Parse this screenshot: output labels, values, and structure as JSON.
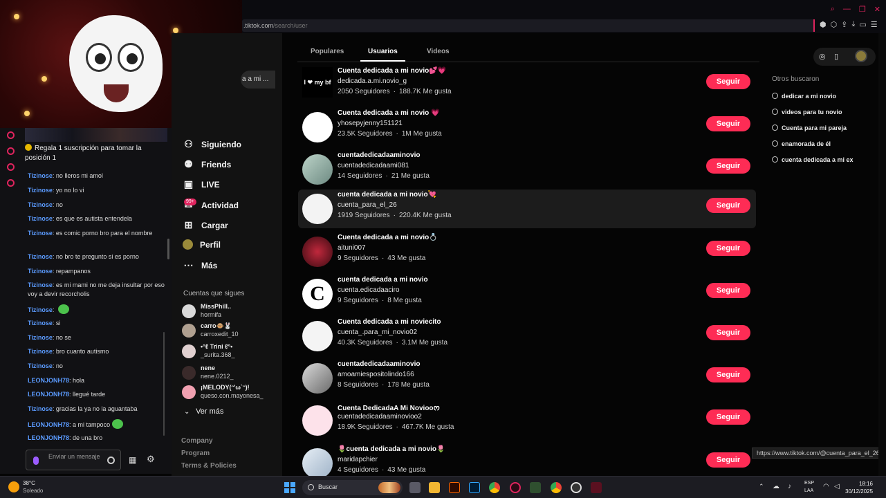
{
  "browser": {
    "url_host": ".tiktok.com",
    "url_path": "/search/user"
  },
  "search": {
    "query_visible": "a a mi ..."
  },
  "nav": {
    "items": [
      {
        "label": "Siguiendo",
        "icon": "following-icon"
      },
      {
        "label": "Friends",
        "icon": "friends-icon"
      },
      {
        "label": "LIVE",
        "icon": "live-icon"
      },
      {
        "label": "Actividad",
        "icon": "activity-icon",
        "badge": "99+"
      },
      {
        "label": "Cargar",
        "icon": "upload-icon"
      },
      {
        "label": "Perfil",
        "icon": "profile-icon"
      },
      {
        "label": "Más",
        "icon": "more-icon"
      }
    ],
    "following_title": "Cuentas que sigues",
    "following": [
      {
        "name": "MissPhill..",
        "sub": "hormifa"
      },
      {
        "name": "carro🐵🐰",
        "sub": "carroxedit_10"
      },
      {
        "name": "•°ℓ Trini ℓ°•",
        "sub": "_surita.368_"
      },
      {
        "name": "nene",
        "sub": "nene.0212_"
      },
      {
        "name": "¡MELODY(ᵔ'ω`ᵔ)!",
        "sub": "queso.con.mayonesa_"
      }
    ],
    "see_more": "Ver más",
    "footer": [
      "Company",
      "Program",
      "Terms & Policies"
    ]
  },
  "tabs": [
    "Populares",
    "Usuarios",
    "Videos"
  ],
  "users": [
    {
      "name": "Cuenta dedicada a mi novio💕💗",
      "handle": "dedicada.a.mi.novio_g",
      "followers": "2050 Seguidores",
      "likes": "188.7K Me gusta",
      "avatar_text": "I ❤ my bf"
    },
    {
      "name": "Cuenta dedicada a mi novio 💗",
      "handle": "yhosepyjenny151121",
      "followers": "23.5K Seguidores",
      "likes": "1M Me gusta",
      "avatar_text": ""
    },
    {
      "name": "cuentadedicadaaminovio",
      "handle": "cuentadedicadaami081",
      "followers": "14 Seguidores",
      "likes": "21 Me gusta",
      "avatar_text": ""
    },
    {
      "name": "cuenta dedicada a mi novio💘",
      "handle": "cuenta_para_el_26",
      "followers": "1919 Seguidores",
      "likes": "220.4K Me gusta",
      "avatar_text": ""
    },
    {
      "name": "Cuenta dedicada a mi novio💍",
      "handle": "aituni007",
      "followers": "9 Seguidores",
      "likes": "43 Me gusta",
      "avatar_text": ""
    },
    {
      "name": "cuenta dedicada a mi novio",
      "handle": "cuenta.edicadaaciro",
      "followers": "9 Seguidores",
      "likes": "8 Me gusta",
      "avatar_text": "C"
    },
    {
      "name": "Cuenta dedicada a mi noviecito",
      "handle": "cuenta_.para_mi_novio02",
      "followers": "40.3K Seguidores",
      "likes": "3.1M Me gusta",
      "avatar_text": ""
    },
    {
      "name": "cuentadedicadaaminovio",
      "handle": "amoamiespositolindo166",
      "followers": "8 Seguidores",
      "likes": "178 Me gusta",
      "avatar_text": ""
    },
    {
      "name": "Cuenta DedicadaA Mi Noviooᰔ",
      "handle": "cuentadedicadaaminovioo2",
      "followers": "18.9K Seguidores",
      "likes": "467.7K Me gusta",
      "avatar_text": ""
    },
    {
      "name": "🌷cuenta dedicada a mi novio🌷",
      "handle": "maridapchier",
      "followers": "4 Seguidores",
      "likes": "43 Me gusta",
      "avatar_text": ""
    }
  ],
  "follow_label": "Seguir",
  "stat_sep": "·",
  "others": {
    "title": "Otros buscaron",
    "items": [
      "dedicar a mi novio",
      "videos para tu novio",
      "Cuenta para mi pareja",
      "enamorada de él",
      "cuenta dedicada a mi ex"
    ]
  },
  "status_url": "https://www.tiktok.com/@cuenta_para_el_26",
  "chat": {
    "banner": "Regala 1 suscripción para tomar la posición 1",
    "messages": [
      {
        "user": "Tizinose",
        "text": "no lleros mi amol"
      },
      {
        "user": "Tizinose",
        "text": "yo no lo vi"
      },
      {
        "user": "Tizinose",
        "text": "no"
      },
      {
        "user": "Tizinose",
        "text": "es que es autista entendela"
      },
      {
        "user": "Tizinose",
        "text": "es comic porno bro para el nombre"
      },
      {
        "user": "Tizinose",
        "text": "no bro te pregunto si es porno"
      },
      {
        "user": "Tizinose",
        "text": "repampanos"
      },
      {
        "user": "Tizinose",
        "text": "es mi mami no me deja insultar por eso voy a devir recorcholis"
      },
      {
        "user": "Tizinose",
        "text": ""
      },
      {
        "user": "Tizinose",
        "text": "si"
      },
      {
        "user": "Tizinose",
        "text": "no se"
      },
      {
        "user": "Tizinose",
        "text": "bro cuanto autismo"
      },
      {
        "user": "Tizinose",
        "text": "no"
      },
      {
        "user": "LEONJONH78",
        "text": "hola"
      },
      {
        "user": "LEONJONH78",
        "text": "llegué tarde"
      },
      {
        "user": "Tizinose",
        "text": "gracias la ya no la aguantaba"
      },
      {
        "user": "LEONJONH78",
        "text": "a mi tampoco"
      },
      {
        "user": "LEONJONH78",
        "text": "de una bro"
      }
    ],
    "input_placeholder": "Enviar un mensaje"
  },
  "taskbar": {
    "temp": "38°C",
    "weather": "Soleado",
    "search_label": "Buscar",
    "lang1": "ESP",
    "lang2": "LAA",
    "time": "18:16",
    "date": "30/12/2025"
  },
  "colors": {
    "accent": "#fe2c55",
    "chat_user": "#5b9bff",
    "chat_user_alt": "#5b9bff"
  }
}
